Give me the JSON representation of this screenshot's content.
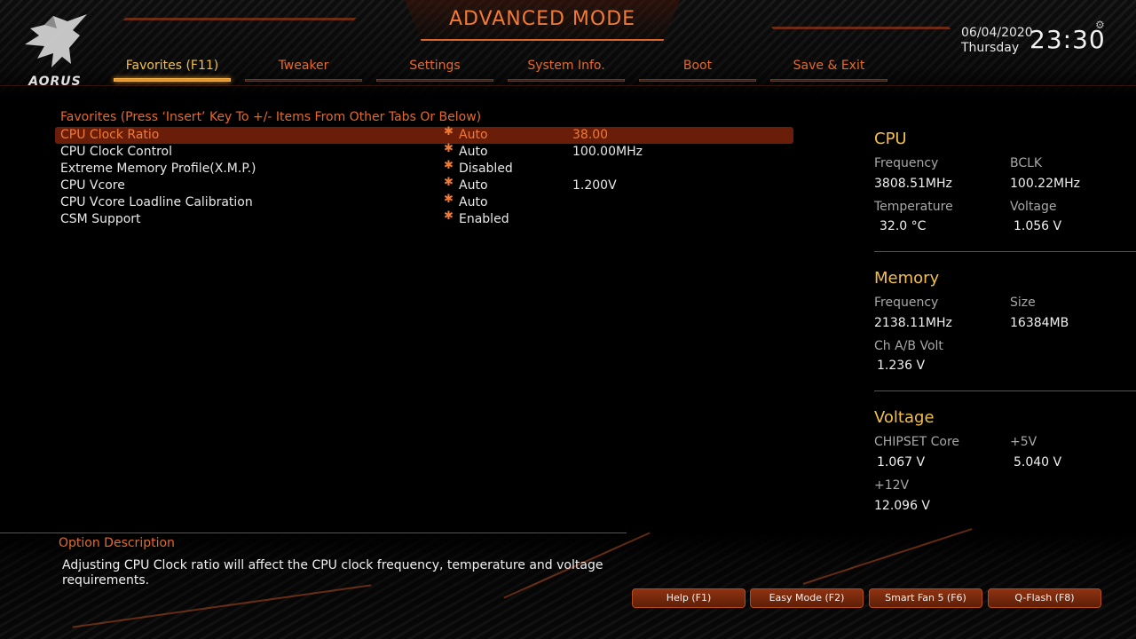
{
  "brand": {
    "logo_text": "AORUS"
  },
  "header": {
    "title": "ADVANCED MODE",
    "date": "06/04/2020",
    "day": "Thursday",
    "time": "23:30",
    "settings_icon": "gear-icon"
  },
  "tabs": [
    {
      "label": "Favorites (F11)",
      "active": true
    },
    {
      "label": "Tweaker"
    },
    {
      "label": "Settings"
    },
    {
      "label": "System Info."
    },
    {
      "label": "Boot"
    },
    {
      "label": "Save & Exit"
    }
  ],
  "favorites": {
    "header": "Favorites (Press ‘Insert’ Key To +/- Items From Other Tabs Or Below)",
    "items": [
      {
        "label": "CPU Clock Ratio",
        "value": "Auto",
        "extra": "38.00",
        "selected": true
      },
      {
        "label": "CPU Clock Control",
        "value": "Auto",
        "extra": "100.00MHz"
      },
      {
        "label": "Extreme Memory Profile(X.M.P.)",
        "value": "Disabled",
        "extra": ""
      },
      {
        "label": "CPU Vcore",
        "value": "Auto",
        "extra": "1.200V"
      },
      {
        "label": "CPU Vcore Loadline Calibration",
        "value": "Auto",
        "extra": ""
      },
      {
        "label": "CSM Support",
        "value": "Enabled",
        "extra": ""
      }
    ]
  },
  "cpu": {
    "title": "CPU",
    "frequency_label": "Frequency",
    "frequency": "3808.51MHz",
    "bclk_label": "BCLK",
    "bclk": "100.22MHz",
    "temperature_label": "Temperature",
    "temperature": "32.0 °C",
    "voltage_label": "Voltage",
    "voltage": "1.056 V"
  },
  "memory": {
    "title": "Memory",
    "frequency_label": "Frequency",
    "frequency": "2138.11MHz",
    "size_label": "Size",
    "size": "16384MB",
    "volt_label": "Ch A/B Volt",
    "volt": "1.236 V"
  },
  "voltage": {
    "title": "Voltage",
    "chipset_label": "CHIPSET Core",
    "chipset": "1.067 V",
    "p5v_label": "+5V",
    "p5v": "5.040 V",
    "p12v_label": "+12V",
    "p12v": "12.096 V"
  },
  "option_description": {
    "title": "Option Description",
    "text": "Adjusting CPU Clock ratio will affect the CPU clock frequency, temperature and voltage requirements."
  },
  "footer_buttons": [
    {
      "label": "Help (F1)"
    },
    {
      "label": "Easy Mode (F2)"
    },
    {
      "label": "Smart Fan 5 (F6)"
    },
    {
      "label": "Q-Flash (F8)"
    }
  ],
  "colors": {
    "accent": "#e46a2c",
    "highlight": "#f2c04a",
    "selected_row": "#6a1e0a"
  }
}
